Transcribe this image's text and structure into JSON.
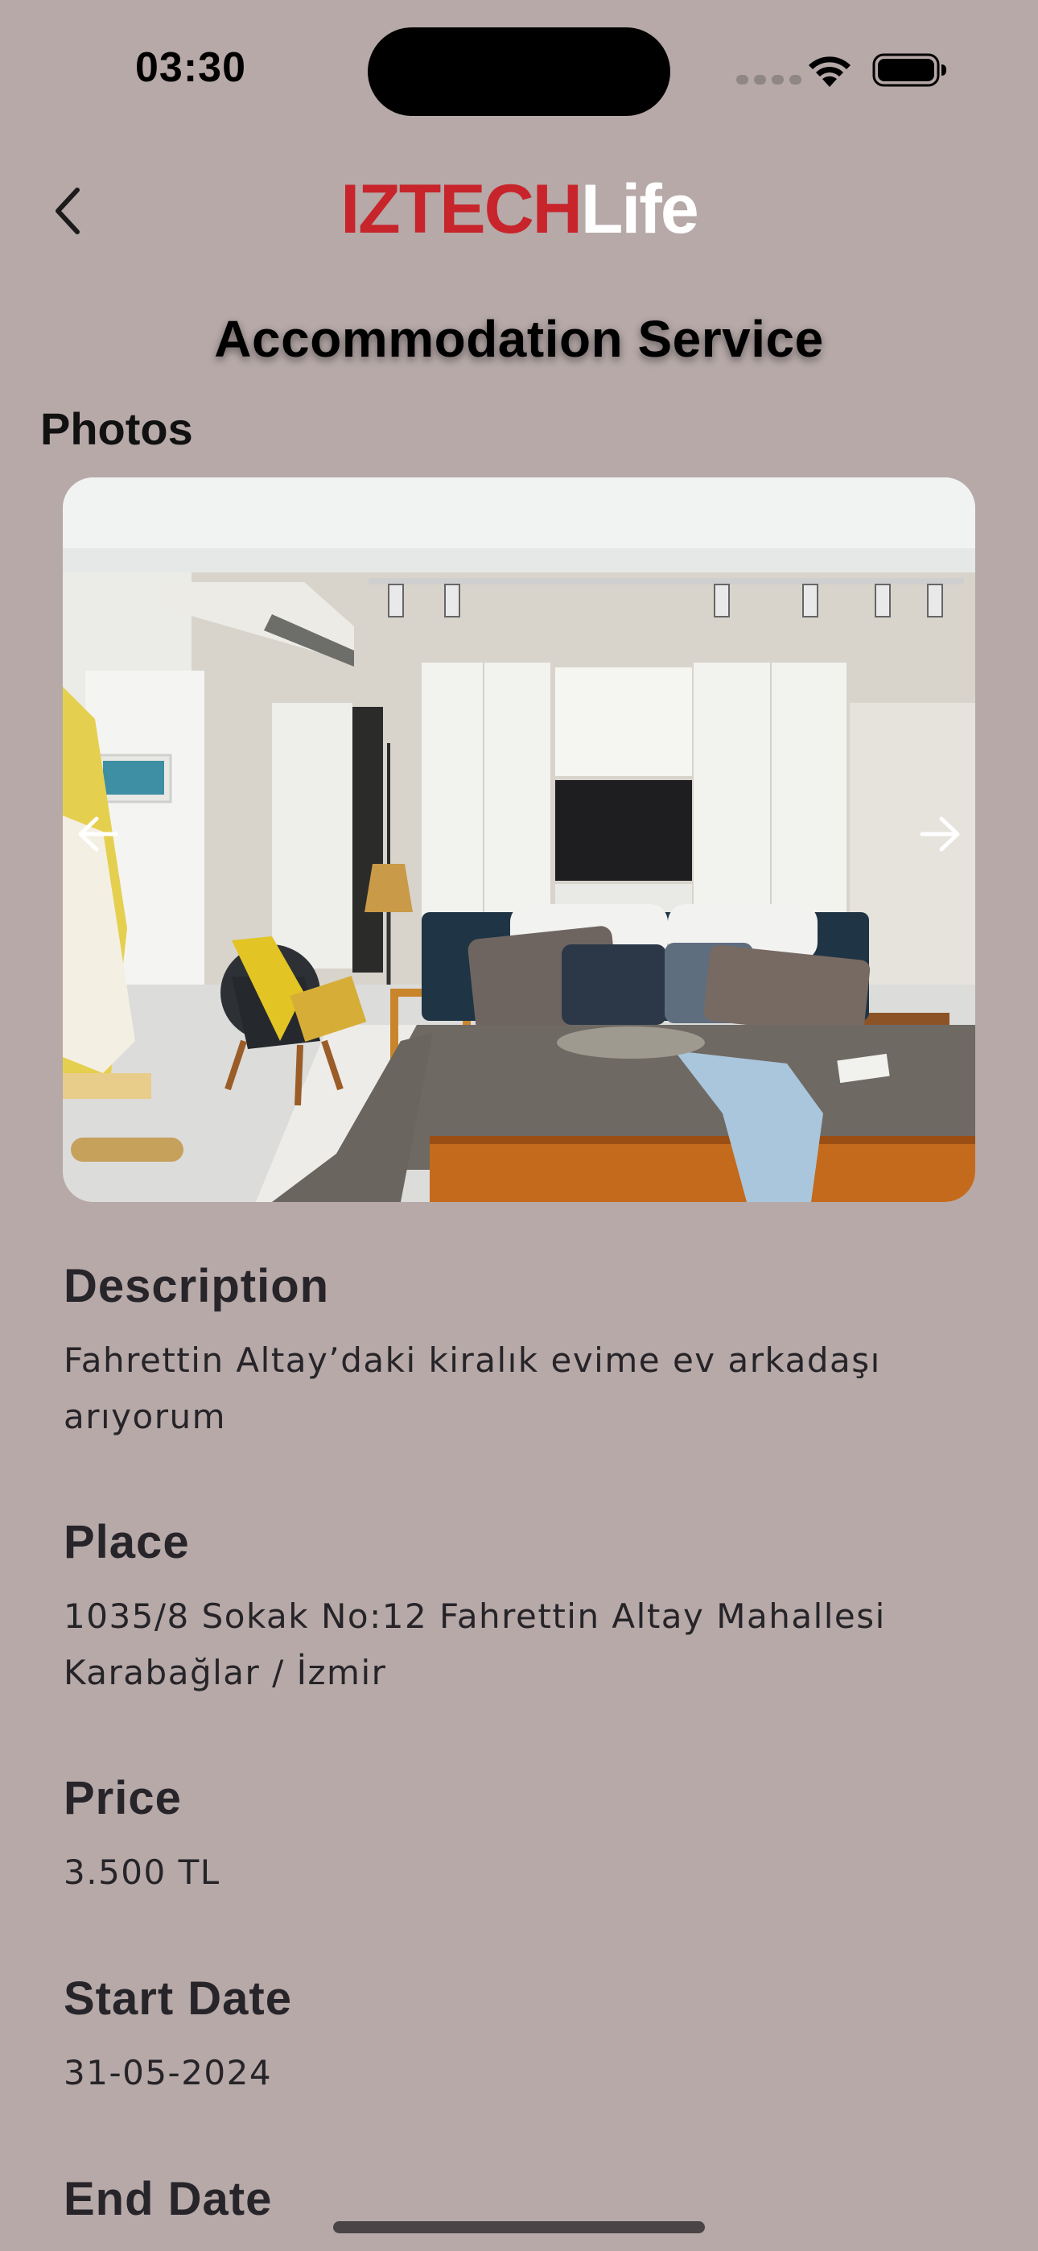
{
  "status_bar": {
    "time": "03:30"
  },
  "header": {
    "brand_part1": "IZTECH",
    "brand_part2": "Life",
    "brand_color_primary": "#c8242b",
    "brand_color_secondary": "#ffffff",
    "back_icon": "chevron-left-icon"
  },
  "page": {
    "title": "Accommodation Service",
    "photos_label": "Photos"
  },
  "carousel": {
    "prev_icon": "arrow-left-icon",
    "next_icon": "arrow-right-icon"
  },
  "details": {
    "description": {
      "label": "Description",
      "value": "Fahrettin Altay’daki kiralık evime ev arkadaşı arıyorum"
    },
    "place": {
      "label": "Place",
      "value": "1035/8 Sokak No:12 Fahrettin Altay Mahallesi Karabağlar / İzmir"
    },
    "price": {
      "label": "Price",
      "value": "3.500 TL"
    },
    "start_date": {
      "label": "Start Date",
      "value": "31-05-2024"
    },
    "end_date": {
      "label": "End Date"
    }
  },
  "colors": {
    "background": "#b6a9a8",
    "text": "#262428"
  }
}
